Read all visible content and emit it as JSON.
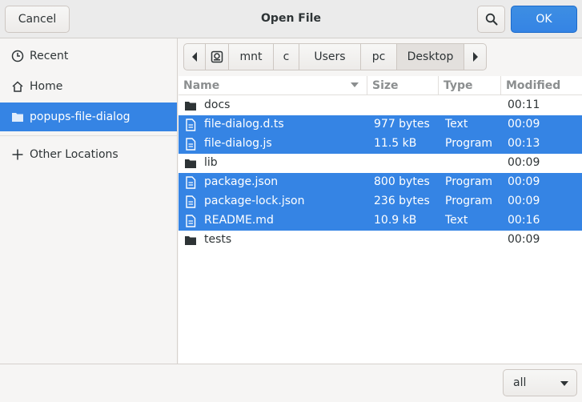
{
  "header": {
    "cancel_label": "Cancel",
    "title": "Open File",
    "ok_label": "OK",
    "search_icon": "search-icon"
  },
  "sidebar": {
    "items": [
      {
        "label": "Recent",
        "icon": "clock-icon"
      },
      {
        "label": "Home",
        "icon": "home-icon"
      },
      {
        "label": "popups-file-dialog",
        "icon": "folder-icon",
        "selected": true
      },
      {
        "label": "Other Locations",
        "icon": "plus-icon"
      }
    ]
  },
  "pathbar": {
    "segments": [
      "mnt",
      "c",
      "Users",
      "pc",
      "Desktop"
    ],
    "drive_icon": "drive-icon"
  },
  "columns": {
    "name": "Name",
    "size": "Size",
    "type": "Type",
    "modified": "Modified"
  },
  "files": [
    {
      "name": "docs",
      "size": "",
      "type": "",
      "modified": "00:11",
      "kind": "folder",
      "selected": false
    },
    {
      "name": "file-dialog.d.ts",
      "size": "977 bytes",
      "type": "Text",
      "modified": "00:09",
      "kind": "file",
      "selected": true
    },
    {
      "name": "file-dialog.js",
      "size": "11.5 kB",
      "type": "Program",
      "modified": "00:13",
      "kind": "file",
      "selected": true
    },
    {
      "name": "lib",
      "size": "",
      "type": "",
      "modified": "00:09",
      "kind": "folder",
      "selected": false
    },
    {
      "name": "package.json",
      "size": "800 bytes",
      "type": "Program",
      "modified": "00:09",
      "kind": "file",
      "selected": true
    },
    {
      "name": "package-lock.json",
      "size": "236 bytes",
      "type": "Program",
      "modified": "00:09",
      "kind": "file",
      "selected": true
    },
    {
      "name": "README.md",
      "size": "10.9 kB",
      "type": "Text",
      "modified": "00:16",
      "kind": "file",
      "selected": true
    },
    {
      "name": "tests",
      "size": "",
      "type": "",
      "modified": "00:09",
      "kind": "folder",
      "selected": false
    }
  ],
  "footer": {
    "filter_value": "all"
  },
  "colors": {
    "accent": "#3584e4",
    "header_bg": "#ebebeb",
    "sidebar_bg": "#f6f5f4"
  }
}
